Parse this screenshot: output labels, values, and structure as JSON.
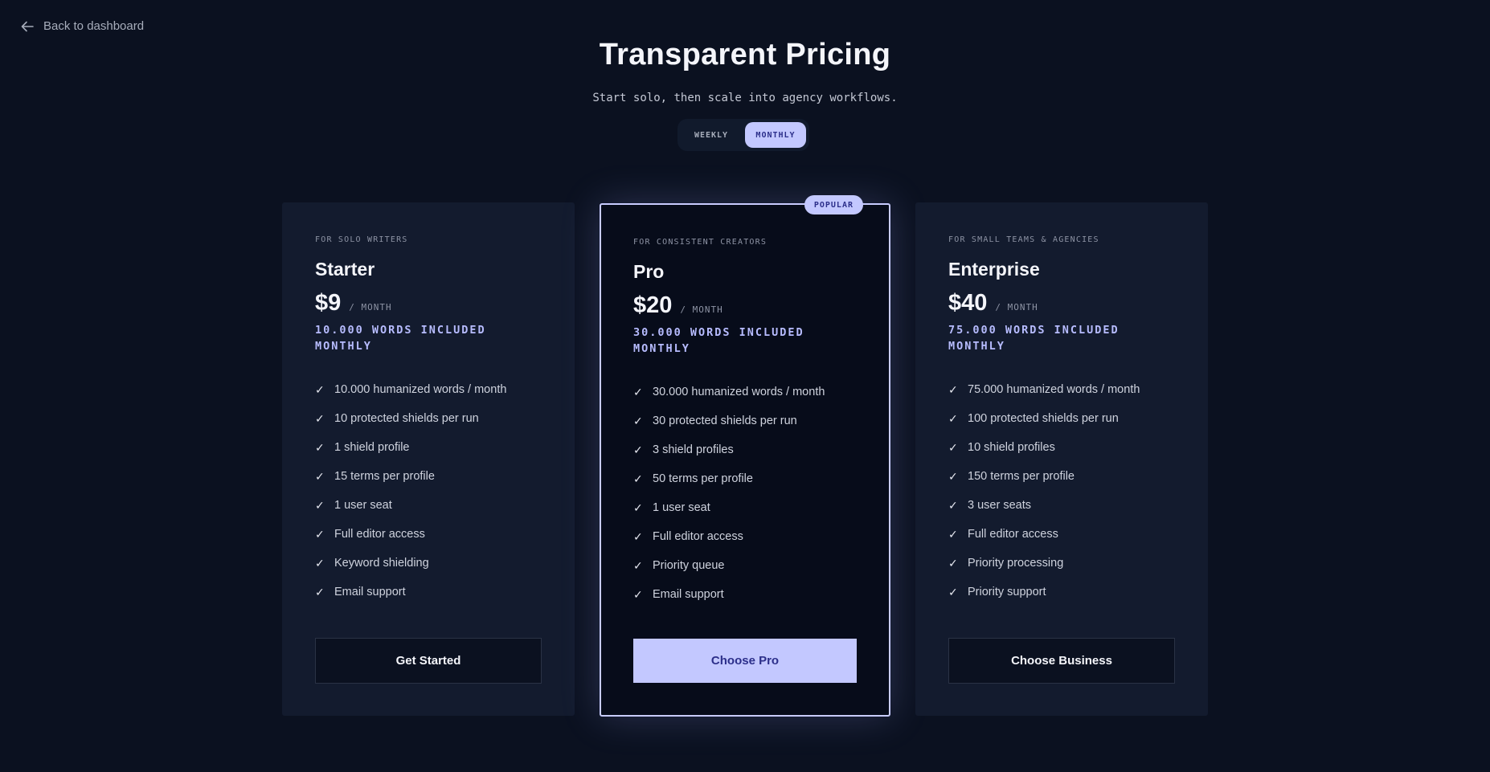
{
  "nav": {
    "back_label": "Back to dashboard"
  },
  "header": {
    "title": "Transparent Pricing",
    "subtitle": "Start solo, then scale into agency workflows."
  },
  "billing_toggle": {
    "options": [
      "WEEKLY",
      "MONTHLY"
    ],
    "selected": "MONTHLY"
  },
  "plans": [
    {
      "kicker": "FOR SOLO WRITERS",
      "name": "Starter",
      "price": "$9",
      "period": "/ MONTH",
      "words": "10.000 WORDS INCLUDED MONTHLY",
      "features": [
        "10.000 humanized words / month",
        "10 protected shields per run",
        "1 shield profile",
        "15 terms per profile",
        "1 user seat",
        "Full editor access",
        "Keyword shielding",
        "Email support"
      ],
      "cta": "Get Started"
    },
    {
      "badge": "POPULAR",
      "kicker": "FOR CONSISTENT CREATORS",
      "name": "Pro",
      "price": "$20",
      "period": "/ MONTH",
      "words": "30.000 WORDS INCLUDED MONTHLY",
      "features": [
        "30.000 humanized words / month",
        "30 protected shields per run",
        "3 shield profiles",
        "50 terms per profile",
        "1 user seat",
        "Full editor access",
        "Priority queue",
        "Email support"
      ],
      "cta": "Choose Pro"
    },
    {
      "kicker": "FOR SMALL TEAMS & AGENCIES",
      "name": "Enterprise",
      "price": "$40",
      "period": "/ MONTH",
      "words": "75.000 WORDS INCLUDED MONTHLY",
      "features": [
        "75.000 humanized words / month",
        "100 protected shields per run",
        "10 shield profiles",
        "150 terms per profile",
        "3 user seats",
        "Full editor access",
        "Priority processing",
        "Priority support"
      ],
      "cta": "Choose Business"
    }
  ],
  "check_glyph": "✓",
  "colors": {
    "background": "#0b1120",
    "card": "#131b2e",
    "accent": "#c3c8ff",
    "accent_text": "#2c2f8a"
  }
}
